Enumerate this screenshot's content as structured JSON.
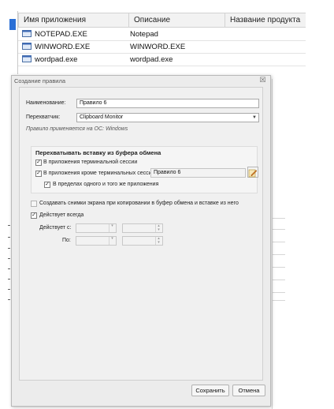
{
  "table": {
    "headers": [
      "Имя приложения",
      "Описание",
      "Название продукта"
    ],
    "rows": [
      {
        "name": "NOTEPAD.EXE",
        "description": "Notepad",
        "icon": "app-window-icon"
      },
      {
        "name": "WINWORD.EXE",
        "description": "WINWORD.EXE",
        "icon": "app-window-icon"
      },
      {
        "name": "wordpad.exe",
        "description": "wordpad.exe",
        "icon": "app-window-icon"
      }
    ]
  },
  "dialog": {
    "title": "Создание правила",
    "close_glyph": "☒",
    "name_label": "Наименование:",
    "name_value": "Правило 6",
    "interceptor_label": "Перехватчик:",
    "interceptor_value": "Clipboard Monitor",
    "os_note": "Правило применяется на ОС: Windows",
    "group_title": "Перехватывать вставку из буфера обмена",
    "cb_terminal": {
      "label": "В приложения терминальной сессии",
      "checked": true
    },
    "cb_except_terminal": {
      "label": "В приложения кроме терминальных сессий",
      "checked": true,
      "value": "Правило 6"
    },
    "cb_same_app": {
      "label": "В пределах одного и того же  приложения",
      "checked": true
    },
    "cb_screenshots": {
      "label": "Создавать снимки экрана при копировании в буфер обмена и вставке из него",
      "checked": false
    },
    "cb_always": {
      "label": "Действует всегда",
      "checked": true
    },
    "active_from_label": "Действует с:",
    "to_label": "По:",
    "save_label": "Сохранить",
    "cancel_label": "Отмена"
  },
  "colors": {
    "selection_marker": "#2a6fd6",
    "dialog_bg": "#ececec"
  }
}
